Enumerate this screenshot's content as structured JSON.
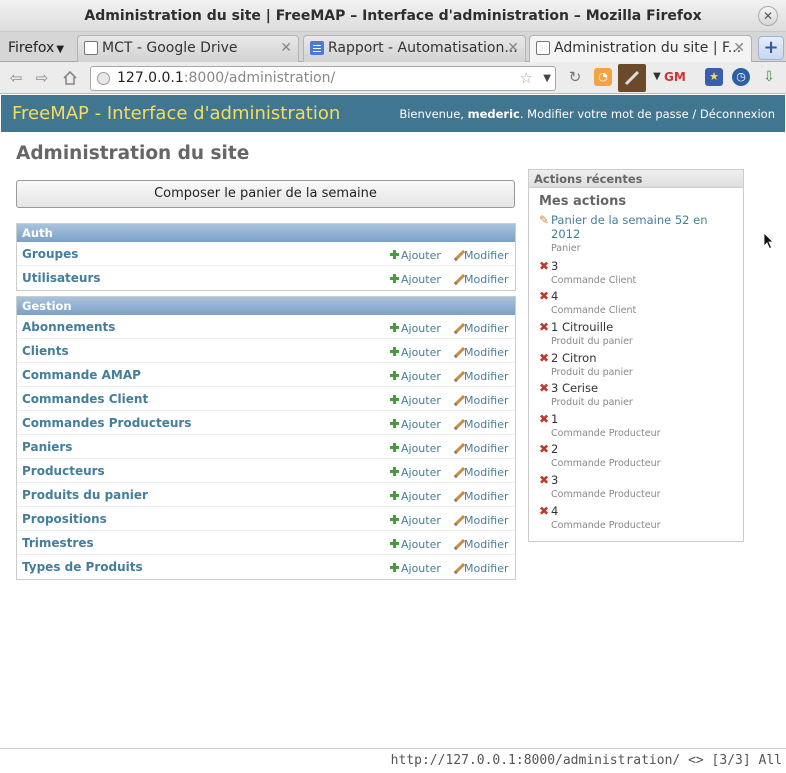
{
  "window": {
    "title": "Administration du site | FreeMAP – Interface d'administration – Mozilla Firefox",
    "close_glyph": "✕"
  },
  "tabs": {
    "firefox_menu": "Firefox",
    "items": [
      {
        "label": "MCT - Google Drive",
        "favicon": "blank-page-icon"
      },
      {
        "label": "Rapport - Automatisation...",
        "favicon": "google-doc-icon"
      },
      {
        "label": "Administration du site | F...",
        "favicon": "blank-page-icon",
        "active": true
      }
    ],
    "close_glyph": "✕",
    "new_tab_glyph": "+"
  },
  "navbar": {
    "url_host": "127.0.0.1",
    "url_port_path": ":8000/administration/"
  },
  "admin": {
    "branding": "FreeMAP - Interface d'administration",
    "welcome": "Bienvenue,",
    "username": "mederic",
    "change_password": "Modifier votre mot de passe",
    "separator": "/",
    "logout": "Déconnexion",
    "page_title": "Administration du site",
    "compose_button": "Composer le panier de la semaine",
    "add_label": "Ajouter",
    "change_label": "Modifier",
    "modules": [
      {
        "caption": "Auth",
        "models": [
          "Groupes",
          "Utilisateurs"
        ]
      },
      {
        "caption": "Gestion",
        "models": [
          "Abonnements",
          "Clients",
          "Commande AMAP",
          "Commandes Client",
          "Commandes Producteurs",
          "Paniers",
          "Producteurs",
          "Produits du panier",
          "Propositions",
          "Trimestres",
          "Types de Produits"
        ]
      }
    ]
  },
  "recent_actions": {
    "caption": "Actions récentes",
    "subtitle": "Mes actions",
    "items": [
      {
        "name": "Panier de la semaine 52 en 2012",
        "type": "Panier",
        "kind": "edit"
      },
      {
        "name": "3",
        "type": "Commande Client",
        "kind": "delete"
      },
      {
        "name": "4",
        "type": "Commande Client",
        "kind": "delete"
      },
      {
        "name": "1 Citrouille",
        "type": "Produit du panier",
        "kind": "delete"
      },
      {
        "name": "2 Citron",
        "type": "Produit du panier",
        "kind": "delete"
      },
      {
        "name": "3 Cerise",
        "type": "Produit du panier",
        "kind": "delete"
      },
      {
        "name": "1",
        "type": "Commande Producteur",
        "kind": "delete"
      },
      {
        "name": "2",
        "type": "Commande Producteur",
        "kind": "delete"
      },
      {
        "name": "3",
        "type": "Commande Producteur",
        "kind": "delete"
      },
      {
        "name": "4",
        "type": "Commande Producteur",
        "kind": "delete"
      }
    ]
  },
  "statusbar": {
    "text": "http://127.0.0.1:8000/administration/ <> [3/3] All"
  },
  "colors": {
    "header_bg": "#417690",
    "branding": "#f5dd5d",
    "link": "#447e9b",
    "delete_icon": "#c0392b"
  }
}
